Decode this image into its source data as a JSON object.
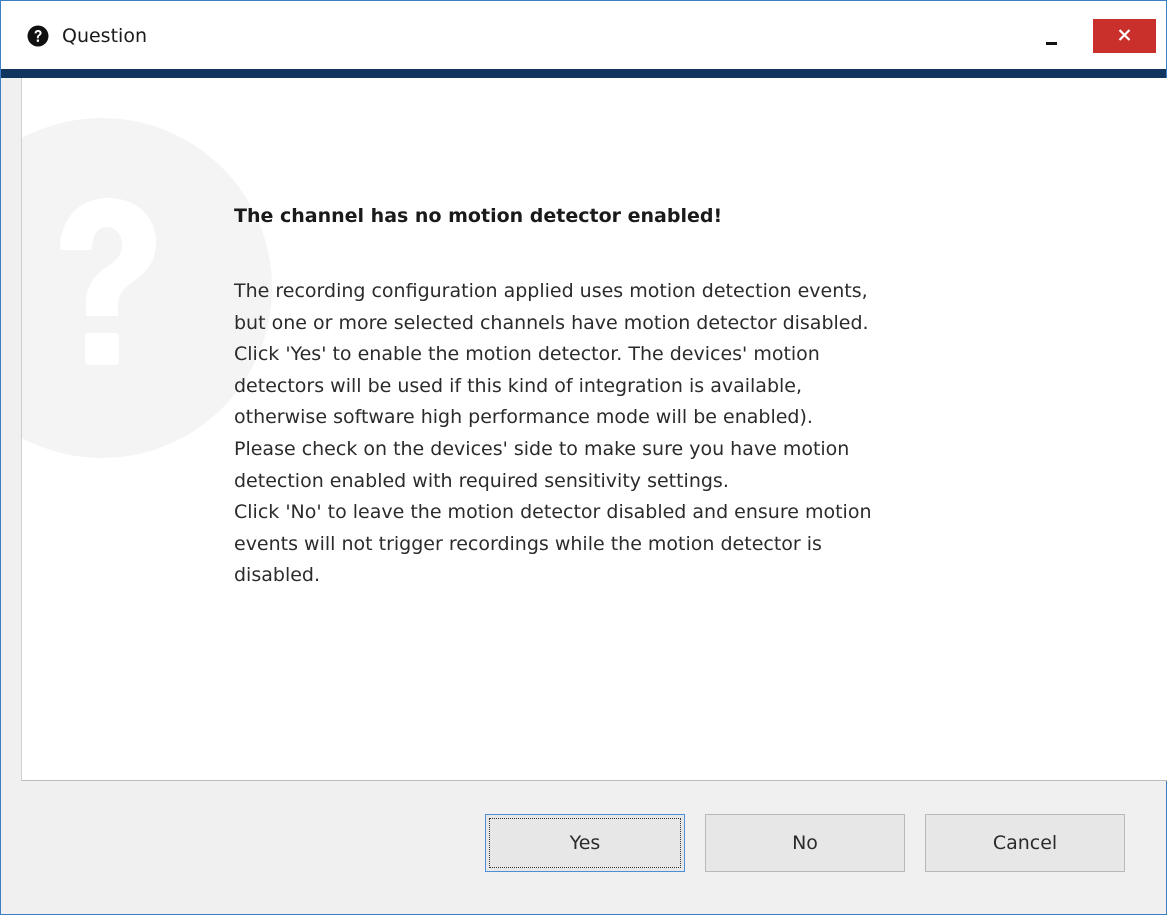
{
  "window": {
    "title": "Question",
    "title_icon": "question-circle-icon",
    "minimize_icon": "minimize-icon",
    "close_icon": "close-icon",
    "accent_color": "#10355e",
    "close_color": "#c9302c"
  },
  "dialog": {
    "watermark_icon": "question-mark-watermark-icon",
    "headline": "The channel has no motion detector enabled!",
    "message_lines": [
      "The recording configuration applied uses motion detection events,",
      "but one or more selected channels have motion detector disabled.",
      "Click 'Yes' to enable the motion detector. The devices' motion",
      "detectors will be used if this kind of integration is available,",
      "otherwise software high performance mode will be enabled).",
      "Please check on the devices' side to make sure you have motion",
      "detection enabled with required sensitivity settings.",
      "Click 'No' to leave the motion detector disabled and ensure motion",
      "events will not trigger recordings while the motion detector is",
      "disabled."
    ]
  },
  "buttons": {
    "yes": "Yes",
    "no": "No",
    "cancel": "Cancel"
  }
}
